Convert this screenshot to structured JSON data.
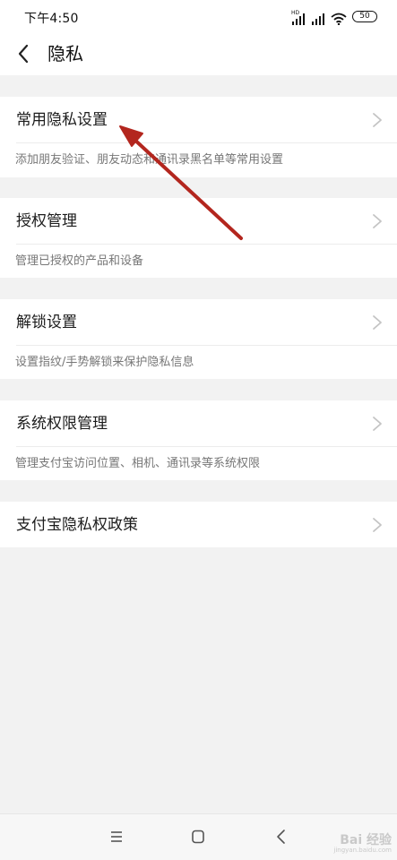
{
  "status_bar": {
    "time": "下午4:50",
    "battery_level": "50",
    "hd_label": "HD",
    "icons": [
      "signal-hd-icon",
      "signal-icon",
      "wifi-icon",
      "battery-icon"
    ]
  },
  "header": {
    "title": "隐私",
    "back_icon": "chevron-left-icon"
  },
  "settings": [
    {
      "label": "常用隐私设置",
      "description": "添加朋友验证、朋友动态和通讯录黑名单等常用设置"
    },
    {
      "label": "授权管理",
      "description": "管理已授权的产品和设备"
    },
    {
      "label": "解锁设置",
      "description": "设置指纹/手势解锁来保护隐私信息"
    },
    {
      "label": "系统权限管理",
      "description": "管理支付宝访问位置、相机、通讯录等系统权限"
    },
    {
      "label": "支付宝隐私权政策",
      "description": ""
    }
  ],
  "nav_bar": {
    "icons": [
      "menu-icon",
      "home-icon",
      "back-icon"
    ]
  },
  "watermark": {
    "logo_text": "Bai 经验",
    "url": "jingyan.baidu.com"
  },
  "colors": {
    "background": "#f2f2f2",
    "card": "#ffffff",
    "annotation_arrow": "#b3261e",
    "description_text": "#777777"
  }
}
